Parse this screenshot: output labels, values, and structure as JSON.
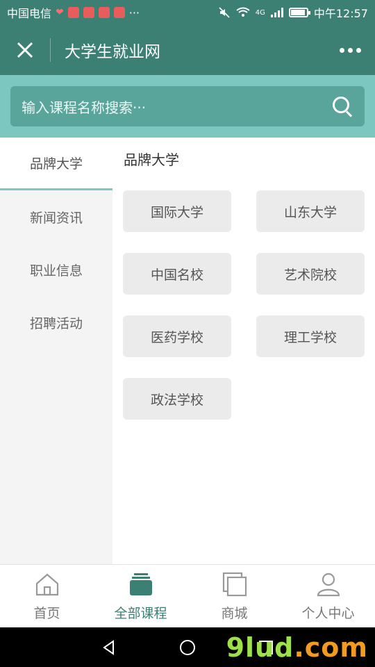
{
  "status_bar": {
    "carrier": "中国电信",
    "more": "···",
    "network": "4G",
    "time": "中午12:57",
    "battery_level": 0.85
  },
  "header": {
    "title": "大学生就业网",
    "close_icon": "close-icon",
    "more_icon": "more-dots-icon"
  },
  "search": {
    "placeholder": "输入课程名称搜索···"
  },
  "sidebar": {
    "items": [
      {
        "label": "品牌大学",
        "active": true
      },
      {
        "label": "新闻资讯",
        "active": false
      },
      {
        "label": "职业信息",
        "active": false
      },
      {
        "label": "招聘活动",
        "active": false
      }
    ]
  },
  "content": {
    "section_title": "品牌大学",
    "chips": [
      "国际大学",
      "山东大学",
      "中国名校",
      "艺术院校",
      "医药学校",
      "理工学校",
      "政法学校"
    ]
  },
  "tabs": [
    {
      "label": "首页",
      "icon": "home-icon",
      "active": false
    },
    {
      "label": "全部课程",
      "icon": "course-stack-icon",
      "active": true
    },
    {
      "label": "商城",
      "icon": "mall-icon",
      "active": false
    },
    {
      "label": "个人中心",
      "icon": "user-icon",
      "active": false
    }
  ],
  "watermark": {
    "brand": "9lud",
    "suffix": ".com"
  },
  "colors": {
    "primary": "#3c7f73",
    "search_bg": "#7cc8c0"
  }
}
